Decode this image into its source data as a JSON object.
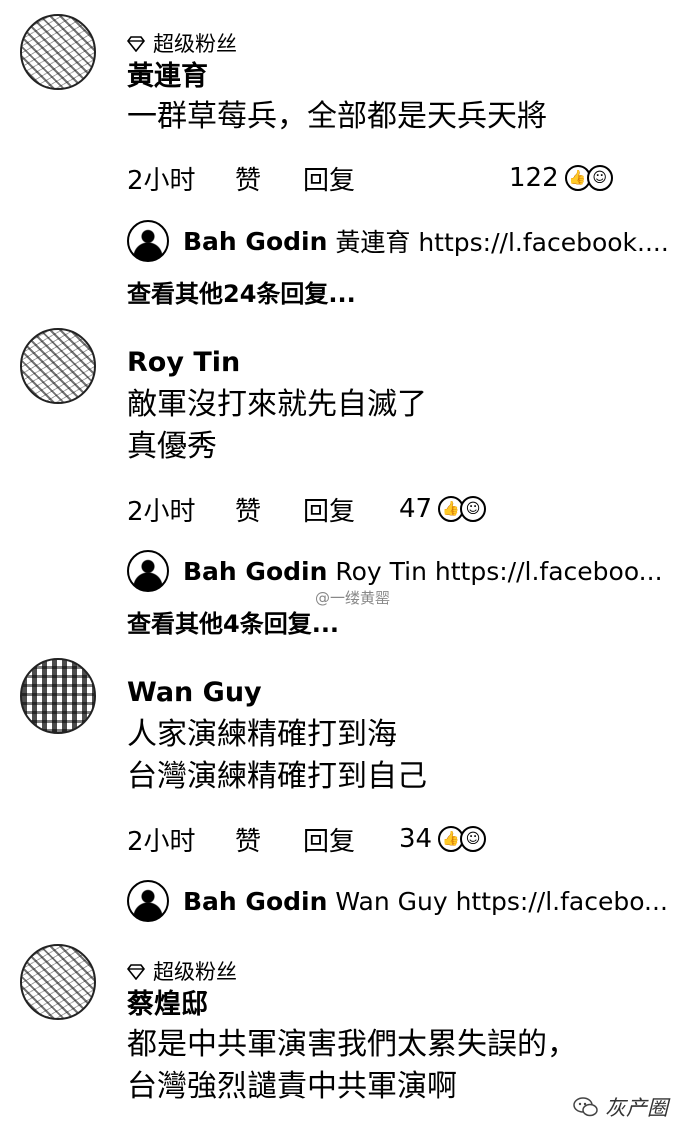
{
  "comments": [
    {
      "badge": "超级粉丝",
      "name": "黃連育",
      "lines": [
        "一群草莓兵，全部都是天兵天將"
      ],
      "time": "2小时",
      "like_label": "赞",
      "reply_label": "回复",
      "reaction_count": "122",
      "reply_preview": {
        "author": "Bah Godin",
        "snippet": "黃連育 https://l.facebook...."
      },
      "more_replies": "查看其他24条回复..."
    },
    {
      "name": "Roy Tin",
      "lines": [
        "敵軍沒打來就先自滅了",
        "真優秀"
      ],
      "time": "2小时",
      "like_label": "赞",
      "reply_label": "回复",
      "reaction_count": "47",
      "reply_preview": {
        "author": "Bah Godin",
        "snippet": "Roy Tin https://l.faceboo..."
      },
      "more_replies": "查看其他4条回复..."
    },
    {
      "name": "Wan Guy",
      "lines": [
        "人家演練精確打到海",
        "台灣演練精確打到自己"
      ],
      "time": "2小时",
      "like_label": "赞",
      "reply_label": "回复",
      "reaction_count": "34",
      "reply_preview": {
        "author": "Bah Godin",
        "snippet": "Wan Guy https://l.facebo..."
      }
    },
    {
      "badge": "超级粉丝",
      "name": "蔡煌邸",
      "lines": [
        "都是中共軍演害我們太累失誤的，",
        "台灣強烈譴責中共軍演啊"
      ]
    }
  ],
  "watermarks": {
    "middle": "@一缕黄罂",
    "corner": "灰产圈"
  },
  "icons": {
    "badge": "diamond-icon",
    "reaction_like": "like-icon",
    "reaction_haha": "haha-icon",
    "watermark": "wechat-icon"
  }
}
